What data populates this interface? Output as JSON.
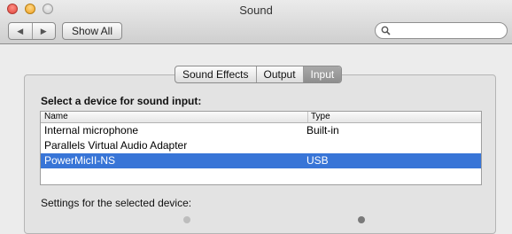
{
  "window": {
    "title": "Sound"
  },
  "toolbar": {
    "back_label": "◀",
    "forward_label": "▶",
    "show_all_label": "Show All"
  },
  "search": {
    "placeholder": "",
    "value": ""
  },
  "tabs": [
    {
      "label": "Sound Effects",
      "selected": false
    },
    {
      "label": "Output",
      "selected": false
    },
    {
      "label": "Input",
      "selected": true
    }
  ],
  "input_panel": {
    "heading": "Select a device for sound input:",
    "columns": [
      "Name",
      "Type"
    ],
    "devices": [
      {
        "name": "Internal microphone",
        "type": "Built-in",
        "selected": false
      },
      {
        "name": "Parallels Virtual Audio Adapter",
        "type": "",
        "selected": false
      },
      {
        "name": "PowerMicII-NS",
        "type": "USB",
        "selected": true
      }
    ],
    "settings_label": "Settings for the selected device:"
  },
  "colors": {
    "selection": "#3875d7",
    "selected_tab": "#9a9a9a",
    "window_bg": "#ececec"
  }
}
